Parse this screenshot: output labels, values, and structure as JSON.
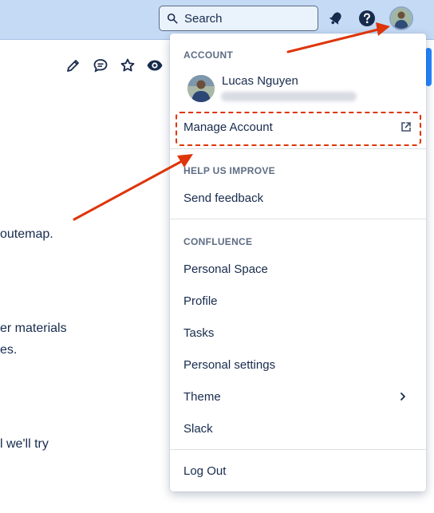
{
  "header": {
    "search_label": "Search"
  },
  "page": {
    "lines": [
      "outemap.",
      "er materials",
      "es.",
      "l we'll try"
    ]
  },
  "menu": {
    "account": {
      "title": "ACCOUNT",
      "user_name": "Lucas Nguyen",
      "manage_label": "Manage Account"
    },
    "help": {
      "title": "HELP US IMPROVE",
      "feedback_label": "Send feedback"
    },
    "confluence": {
      "title": "CONFLUENCE",
      "items": [
        "Personal Space",
        "Profile",
        "Tasks",
        "Personal settings",
        "Theme",
        "Slack"
      ]
    },
    "logout_label": "Log Out"
  },
  "colors": {
    "header_bg": "#c5daf5",
    "annotation": "#de350b",
    "scroll_accent": "#2684ff"
  }
}
